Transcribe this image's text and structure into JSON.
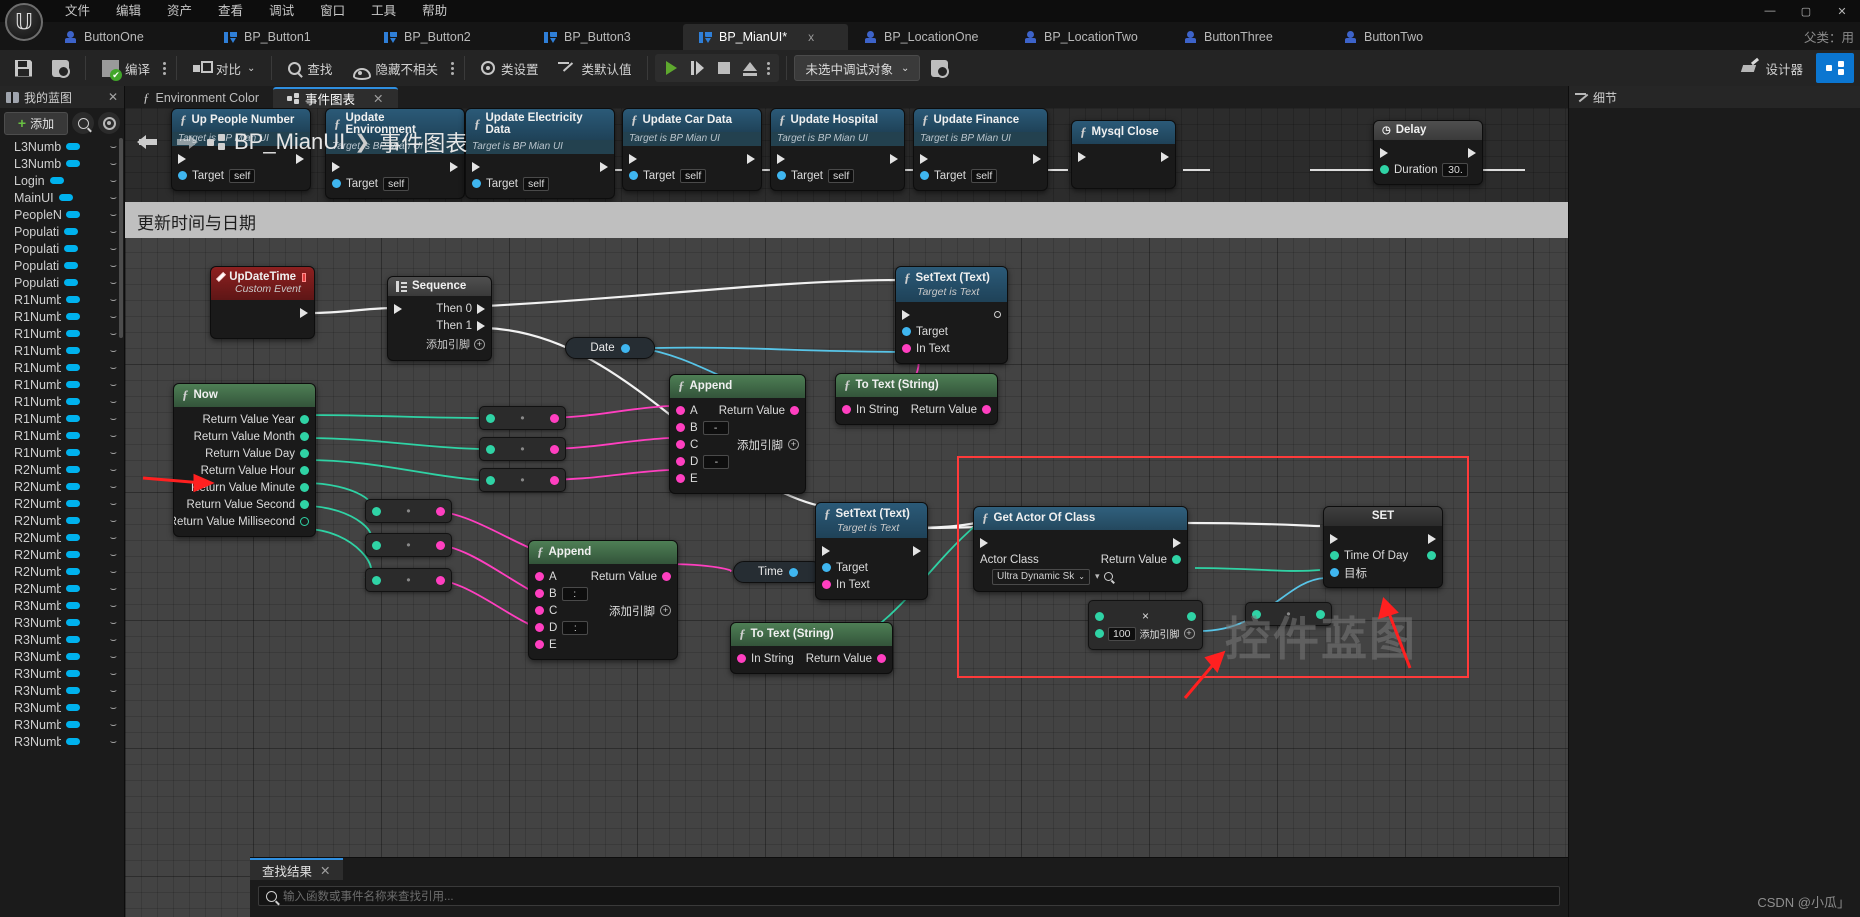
{
  "app": {
    "logo": "unreal-logo",
    "menu": [
      "文件",
      "编辑",
      "资产",
      "查看",
      "调试",
      "窗口",
      "工具",
      "帮助"
    ],
    "window_controls": {
      "minimize": "—",
      "maximize": "▢",
      "close": "✕"
    },
    "watermark": "CSDN @小瓜」"
  },
  "asset_tabs": [
    {
      "label": "ButtonOne",
      "icon": "actor-icon",
      "active": false,
      "dirty": false
    },
    {
      "label": "BP_Button1",
      "icon": "widget-icon",
      "active": false,
      "dirty": false
    },
    {
      "label": "BP_Button2",
      "icon": "widget-icon",
      "active": false,
      "dirty": false
    },
    {
      "label": "BP_Button3",
      "icon": "widget-icon",
      "active": false,
      "dirty": false
    },
    {
      "label": "BP_MianUI*",
      "icon": "widget-icon",
      "active": true,
      "dirty": true,
      "close": "x"
    },
    {
      "label": "BP_LocationOne",
      "icon": "actor-icon",
      "active": false,
      "dirty": false
    },
    {
      "label": "BP_LocationTwo",
      "icon": "actor-icon",
      "active": false,
      "dirty": false
    },
    {
      "label": "ButtonThree",
      "icon": "actor-icon",
      "active": false,
      "dirty": false
    },
    {
      "label": "ButtonTwo",
      "icon": "actor-icon",
      "active": false,
      "dirty": false
    }
  ],
  "parent_class_label": "父类：用",
  "toolbar": {
    "save": "",
    "browse": "",
    "compile": "编译",
    "diff": "对比",
    "find": "查找",
    "hide_unrelated": "隐藏不相关",
    "class_settings": "类设置",
    "class_defaults": "类默认值",
    "debug_object": "未选中调试对象",
    "designer": "设计器",
    "graph": "图表"
  },
  "my_blueprint": {
    "title": "我的蓝图",
    "add_label": "添加",
    "close": "✕",
    "variables": [
      "L3Numb",
      "L3Numb",
      "Login",
      "MainUI",
      "PeopleN",
      "Populati",
      "Populati",
      "Populati",
      "Populati",
      "R1Numb",
      "R1Numb",
      "R1Numb",
      "R1Numb",
      "R1Numb",
      "R1Numb",
      "R1Numb",
      "R1Numb",
      "R1Numb",
      "R1Numb",
      "R2Numb",
      "R2Numb",
      "R2Numb",
      "R2Numb",
      "R2Numb",
      "R2Numb",
      "R2Numb",
      "R2Numb",
      "R3Numb",
      "R3Numb",
      "R3Numb",
      "R3Numb",
      "R3Numb",
      "R3Numb",
      "R3Numb",
      "R3Numb",
      "R3Numb"
    ]
  },
  "graph_tabs": [
    {
      "label": "Environment Color",
      "icon": "function-icon",
      "active": false
    },
    {
      "label": "事件图表",
      "icon": "graph-icon",
      "active": true,
      "close": "✕"
    }
  ],
  "breadcrumb": {
    "root": "BP_MianUI",
    "sep": "❯",
    "leaf": "事件图表"
  },
  "comment_box": {
    "label": "更新时间与日期"
  },
  "top_nodes": [
    {
      "title": "Up People Number",
      "sub": "Target is BP Mian UI",
      "target": "self"
    },
    {
      "title": "Update Environment",
      "sub": "Target is BP Mian UI",
      "target": "self"
    },
    {
      "title": "Update Electricity Data",
      "sub": "Target is BP Mian UI",
      "target": "self"
    },
    {
      "title": "Update Car Data",
      "sub": "Target is BP Mian UI",
      "target": "self"
    },
    {
      "title": "Update Hospital",
      "sub": "Target is BP Mian UI",
      "target": "self"
    },
    {
      "title": "Update Finance",
      "sub": "Target is BP Mian UI",
      "target": "self"
    }
  ],
  "mysql_close": {
    "title": "Mysql Close"
  },
  "delay_node": {
    "title": "Delay",
    "duration_label": "Duration",
    "duration_value": "30."
  },
  "nodes": {
    "update_time": {
      "title": "UpDateTime",
      "subtitle": "Custom Event"
    },
    "sequence": {
      "title": "Sequence",
      "then0": "Then 0",
      "then1": "Then 1",
      "add_pin": "添加引脚"
    },
    "now": {
      "title": "Now",
      "outputs": [
        "Return Value Year",
        "Return Value Month",
        "Return Value Day",
        "Return Value Hour",
        "Return Value Minute",
        "Return Value Second",
        "Return Value Millisecond"
      ]
    },
    "date_reroute": {
      "label": "Date"
    },
    "time_reroute": {
      "label": "Time"
    },
    "append_top": {
      "title": "Append",
      "return": "Return Value",
      "add_pin": "添加引脚",
      "pins": [
        "A",
        "B",
        "C",
        "D",
        "E"
      ],
      "b_value": "-",
      "d_value": "-"
    },
    "append_bottom": {
      "title": "Append",
      "return": "Return Value",
      "add_pin": "添加引脚",
      "pins": [
        "A",
        "B",
        "C",
        "D",
        "E"
      ],
      "b_value": ":",
      "d_value": ":"
    },
    "to_text_top": {
      "title": "To Text (String)",
      "in": "In String",
      "out": "Return Value"
    },
    "to_text_bottom": {
      "title": "To Text (String)",
      "in": "In String",
      "out": "Return Value"
    },
    "settext_top": {
      "title": "SetText (Text)",
      "sub": "Target is Text",
      "target": "Target",
      "intext": "In Text"
    },
    "settext_bottom": {
      "title": "SetText (Text)",
      "sub": "Target is Text",
      "target": "Target",
      "intext": "In Text"
    },
    "get_actor_of_class": {
      "title": "Get Actor Of Class",
      "actor_class": "Actor Class",
      "return": "Return Value",
      "class_value": "Ultra Dynamic Sk"
    },
    "set_node": {
      "title": "SET",
      "time_of_day": "Time Of Day",
      "target": "目标"
    },
    "multiply_node": {
      "op": "×",
      "value": "100",
      "add_pin": "添加引脚"
    }
  },
  "canvas_watermark": "控件蓝图",
  "find_results": {
    "tab": "查找结果",
    "close": "✕",
    "placeholder": "输入函数或事件名称来查找引用..."
  },
  "details": {
    "title": "细节"
  }
}
